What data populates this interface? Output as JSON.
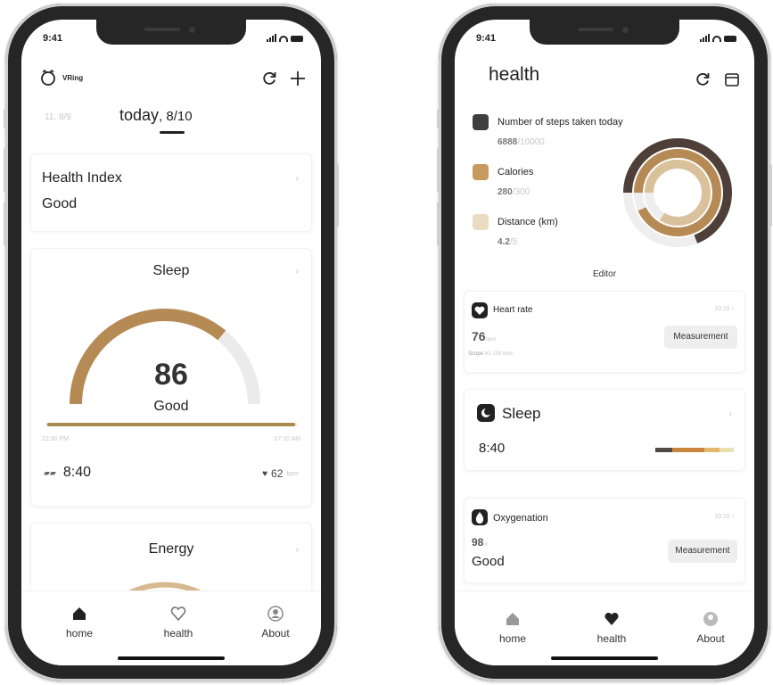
{
  "status": {
    "time": "9:41"
  },
  "home_screen": {
    "logo_text": "VRing",
    "date_prev": "11, 8/9",
    "today_label": "today",
    "today_date": ", 8/10",
    "health_index": {
      "title": "Health Index",
      "value": "Good"
    },
    "sleep": {
      "title": "Sleep",
      "score": "86",
      "quality": "Good",
      "start_time": "22:30 PM",
      "end_time": "07:10 AM",
      "duration": "8:40",
      "heart_rate": "62",
      "heart_unit": "bpm",
      "progress": 0.72
    },
    "energy": {
      "title": "Energy"
    }
  },
  "health_screen": {
    "title": "health",
    "steps": {
      "label": "Number of steps taken today",
      "value": "6888",
      "goal": "/10000"
    },
    "calories": {
      "label": "Calories",
      "value": "280",
      "goal": "/300"
    },
    "distance": {
      "label": "Distance (km)",
      "value": "4.2",
      "goal": "/5"
    },
    "editor_label": "Editor",
    "ring_values": {
      "steps": 0.69,
      "calories": 0.93,
      "distance": 0.84
    },
    "heart_rate": {
      "label": "Heart rate",
      "time": "10:15",
      "value": "76",
      "unit": "bpm",
      "scope_label": "Scope",
      "scope_value": "60-100 bpm",
      "button": "Measurement"
    },
    "sleep": {
      "label": "Sleep",
      "duration": "8:40"
    },
    "oxygenation": {
      "label": "Oxygenation",
      "time": "10:15",
      "value": "98",
      "unit": "%",
      "quality": "Good",
      "button": "Measurement"
    }
  },
  "tabs": [
    {
      "label": "home"
    },
    {
      "label": "health"
    },
    {
      "label": "About"
    }
  ],
  "colors": {
    "accent_brown": "#b58a55",
    "dark_brown": "#4e4038",
    "light_tan": "#d9c19b",
    "track_gray": "#e6e6e6"
  }
}
